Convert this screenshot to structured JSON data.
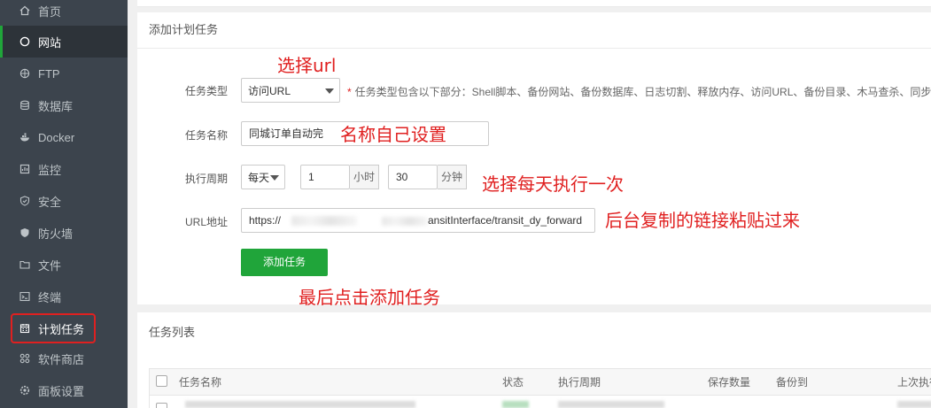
{
  "sidebar": {
    "items": [
      {
        "label": "首页",
        "icon": "home-icon"
      },
      {
        "label": "网站",
        "icon": "globe-icon"
      },
      {
        "label": "FTP",
        "icon": "ftp-icon"
      },
      {
        "label": "数据库",
        "icon": "database-icon"
      },
      {
        "label": "Docker",
        "icon": "docker-icon"
      },
      {
        "label": "监控",
        "icon": "monitor-icon"
      },
      {
        "label": "安全",
        "icon": "shield-check-icon"
      },
      {
        "label": "防火墙",
        "icon": "firewall-shield-icon"
      },
      {
        "label": "文件",
        "icon": "folder-icon"
      },
      {
        "label": "终端",
        "icon": "terminal-icon"
      },
      {
        "label": "计划任务",
        "icon": "calendar-icon"
      },
      {
        "label": "软件商店",
        "icon": "apps-grid-icon"
      },
      {
        "label": "面板设置",
        "icon": "settings-gear-icon"
      }
    ],
    "active_label": "网站",
    "accent_color": "#20a53a"
  },
  "add_task": {
    "title": "添加计划任务",
    "task_type_label": "任务类型",
    "task_type_value": "访问URL",
    "task_type_hint": "任务类型包含以下部分：Shell脚本、备份网站、备份数据库、日志切割、释放内存、访问URL、备份目录、木马查杀、同步",
    "task_name_label": "任务名称",
    "task_name_value": "同城订单自动完",
    "cycle_label": "执行周期",
    "cycle_value": "每天",
    "hour_value": "1",
    "hour_unit": "小时",
    "minute_value": "30",
    "minute_unit": "分钟",
    "url_label": "URL地址",
    "url_prefix": "https://",
    "url_suffix": "ansitInterface/transit_dy_forward",
    "submit_label": "添加任务"
  },
  "annotations": {
    "choose_url": "选择url",
    "name_self": "名称自己设置",
    "daily": "选择每天执行一次",
    "paste_link": "后台复制的链接粘贴过来",
    "click_add": "最后点击添加任务"
  },
  "task_list": {
    "title": "任务列表",
    "columns": [
      "任务名称",
      "状态",
      "执行周期",
      "保存数量",
      "备份到",
      "上次执行"
    ]
  },
  "colors": {
    "annotation_red": "#e02020",
    "button_green": "#20a53a",
    "sidebar_bg": "#3c444d"
  }
}
